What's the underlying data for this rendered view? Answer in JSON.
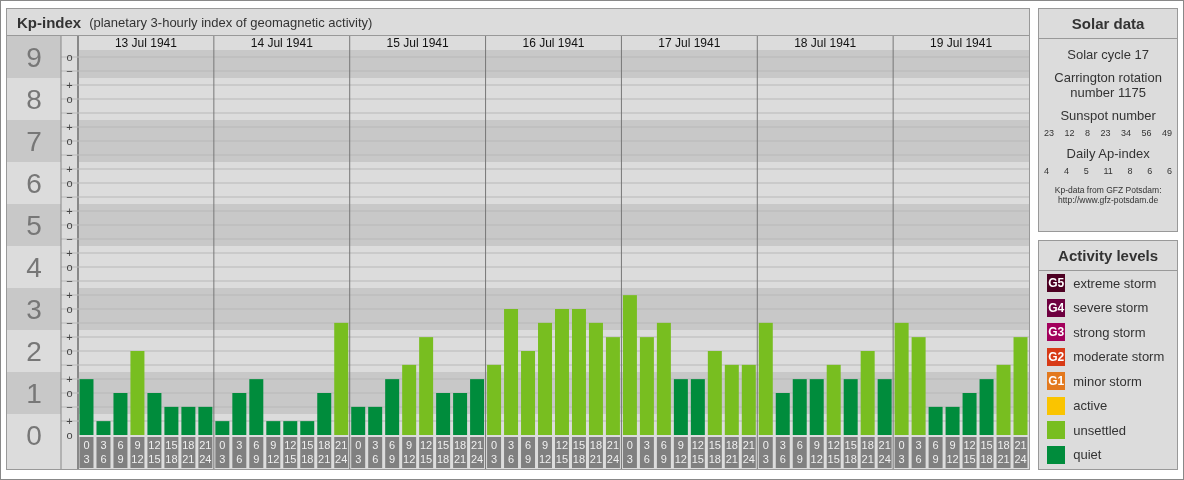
{
  "kp_panel": {
    "title": "Kp-index",
    "subtitle": "(planetary 3-hourly index of geomagnetic activity)",
    "days": [
      "13 Jul 1941",
      "14 Jul 1941",
      "15 Jul 1941",
      "16 Jul 1941",
      "17 Jul 1941",
      "18 Jul 1941",
      "19 Jul 1941"
    ],
    "minor_ticks": [
      "o",
      "−",
      "+",
      "o",
      "−",
      "+",
      "o",
      "−",
      "+",
      "o",
      "−",
      "+",
      "o",
      "−",
      "+",
      "o",
      "−",
      "+",
      "o",
      "−",
      "+",
      "o",
      "−",
      "+",
      "o",
      "−",
      "+",
      "o"
    ],
    "chart_data": {
      "type": "bar",
      "grid": true,
      "ylim": [
        0,
        9
      ],
      "yticks": [
        0,
        1,
        2,
        3,
        4,
        5,
        6,
        7,
        8,
        9
      ],
      "categories": [
        "0 3",
        "3 6",
        "6 9",
        "9 12",
        "12 15",
        "15 18",
        "18 21",
        "21 24",
        "0 3",
        "3 6",
        "6 9",
        "9 12",
        "12 15",
        "15 18",
        "18 21",
        "21 24",
        "0 3",
        "3 6",
        "6 9",
        "9 12",
        "12 15",
        "15 18",
        "18 21",
        "21 24",
        "0 3",
        "3 6",
        "6 9",
        "9 12",
        "12 15",
        "15 18",
        "18 21",
        "21 24",
        "0 3",
        "3 6",
        "6 9",
        "9 12",
        "12 15",
        "15 18",
        "18 21",
        "21 24",
        "0 3",
        "3 6",
        "6 9",
        "9 12",
        "12 15",
        "15 18",
        "18 21",
        "21 24",
        "0 3",
        "3 6",
        "6 9",
        "9 12",
        "12 15",
        "15 18",
        "18 21",
        "21 24"
      ],
      "values": [
        1.33,
        0.33,
        1,
        2,
        1,
        0.67,
        0.67,
        0.67,
        0.33,
        1,
        1.33,
        0.33,
        0.33,
        0.33,
        1,
        2.67,
        0.67,
        0.67,
        1.33,
        1.67,
        2.33,
        1,
        1,
        1.33,
        1.67,
        3,
        2,
        2.67,
        3,
        3,
        2.67,
        2.33,
        3.33,
        2.33,
        2.67,
        1.33,
        1.33,
        2,
        1.67,
        1.67,
        2.67,
        1,
        1.33,
        1.33,
        1.67,
        1.33,
        2,
        1.33,
        2.67,
        2.33,
        0.67,
        0.67,
        1,
        1.33,
        1.67,
        2.33
      ]
    }
  },
  "solar_data": {
    "title": "Solar data",
    "cycle": "Solar cycle 17",
    "rotation": "Carrington rotation number 1175",
    "sunspot_title": "Sunspot number",
    "sunspot_numbers": [
      "23",
      "12",
      "8",
      "23",
      "34",
      "56",
      "49"
    ],
    "ap_title": "Daily Ap-index",
    "ap_values": [
      "4",
      "4",
      "5",
      "11",
      "8",
      "6",
      "6"
    ],
    "source": "Kp-data from GFZ Potsdam:",
    "source_url": "http://www.gfz-potsdam.de"
  },
  "activity_levels": {
    "title": "Activity levels",
    "items": [
      {
        "badge": "G5",
        "label": "extreme storm",
        "color": "#4d0022"
      },
      {
        "badge": "G4",
        "label": "severe storm",
        "color": "#6e0040"
      },
      {
        "badge": "G3",
        "label": "strong storm",
        "color": "#a3005c"
      },
      {
        "badge": "G2",
        "label": "moderate storm",
        "color": "#d83a16"
      },
      {
        "badge": "G1",
        "label": "minor storm",
        "color": "#e3791e"
      },
      {
        "label": "active",
        "color": "#fac400"
      },
      {
        "label": "unsettled",
        "color": "#78be20"
      },
      {
        "label": "quiet",
        "color": "#008c3c"
      }
    ]
  }
}
